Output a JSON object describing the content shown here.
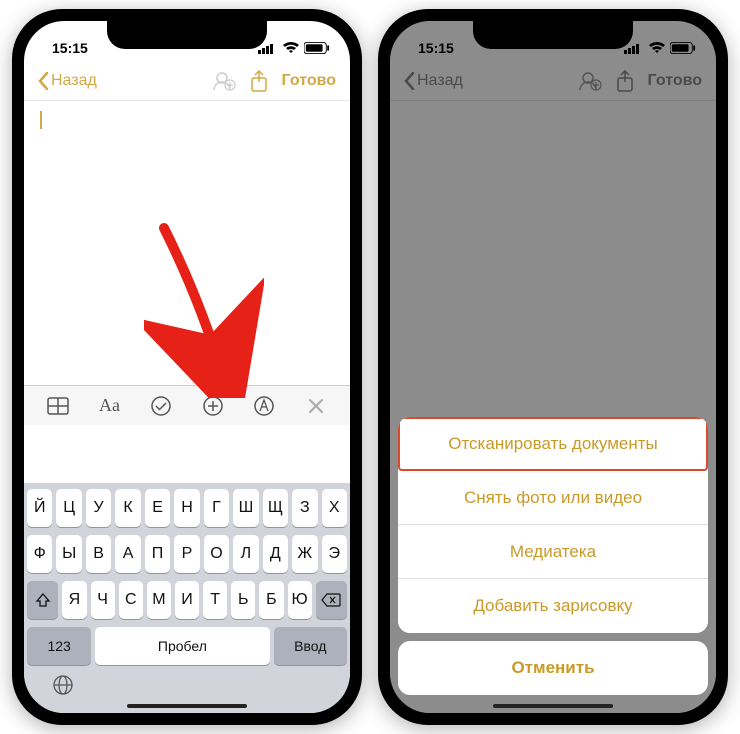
{
  "status": {
    "time": "15:15"
  },
  "nav": {
    "back_label": "Назад",
    "done_label": "Готово"
  },
  "toolbar": {
    "icons": [
      "table",
      "text-format",
      "checklist",
      "add",
      "markup",
      "close"
    ]
  },
  "keyboard": {
    "row1": [
      "Й",
      "Ц",
      "У",
      "К",
      "Е",
      "Н",
      "Г",
      "Ш",
      "Щ",
      "З",
      "Х"
    ],
    "row2": [
      "Ф",
      "Ы",
      "В",
      "А",
      "П",
      "Р",
      "О",
      "Л",
      "Д",
      "Ж",
      "Э"
    ],
    "row3": [
      "Я",
      "Ч",
      "С",
      "М",
      "И",
      "Т",
      "Ь",
      "Б",
      "Ю"
    ],
    "num_label": "123",
    "space_label": "Пробел",
    "enter_label": "Ввод"
  },
  "action_sheet": {
    "items": [
      "Отсканировать документы",
      "Снять фото или видео",
      "Медиатека",
      "Добавить зарисовку"
    ],
    "cancel_label": "Отменить"
  }
}
